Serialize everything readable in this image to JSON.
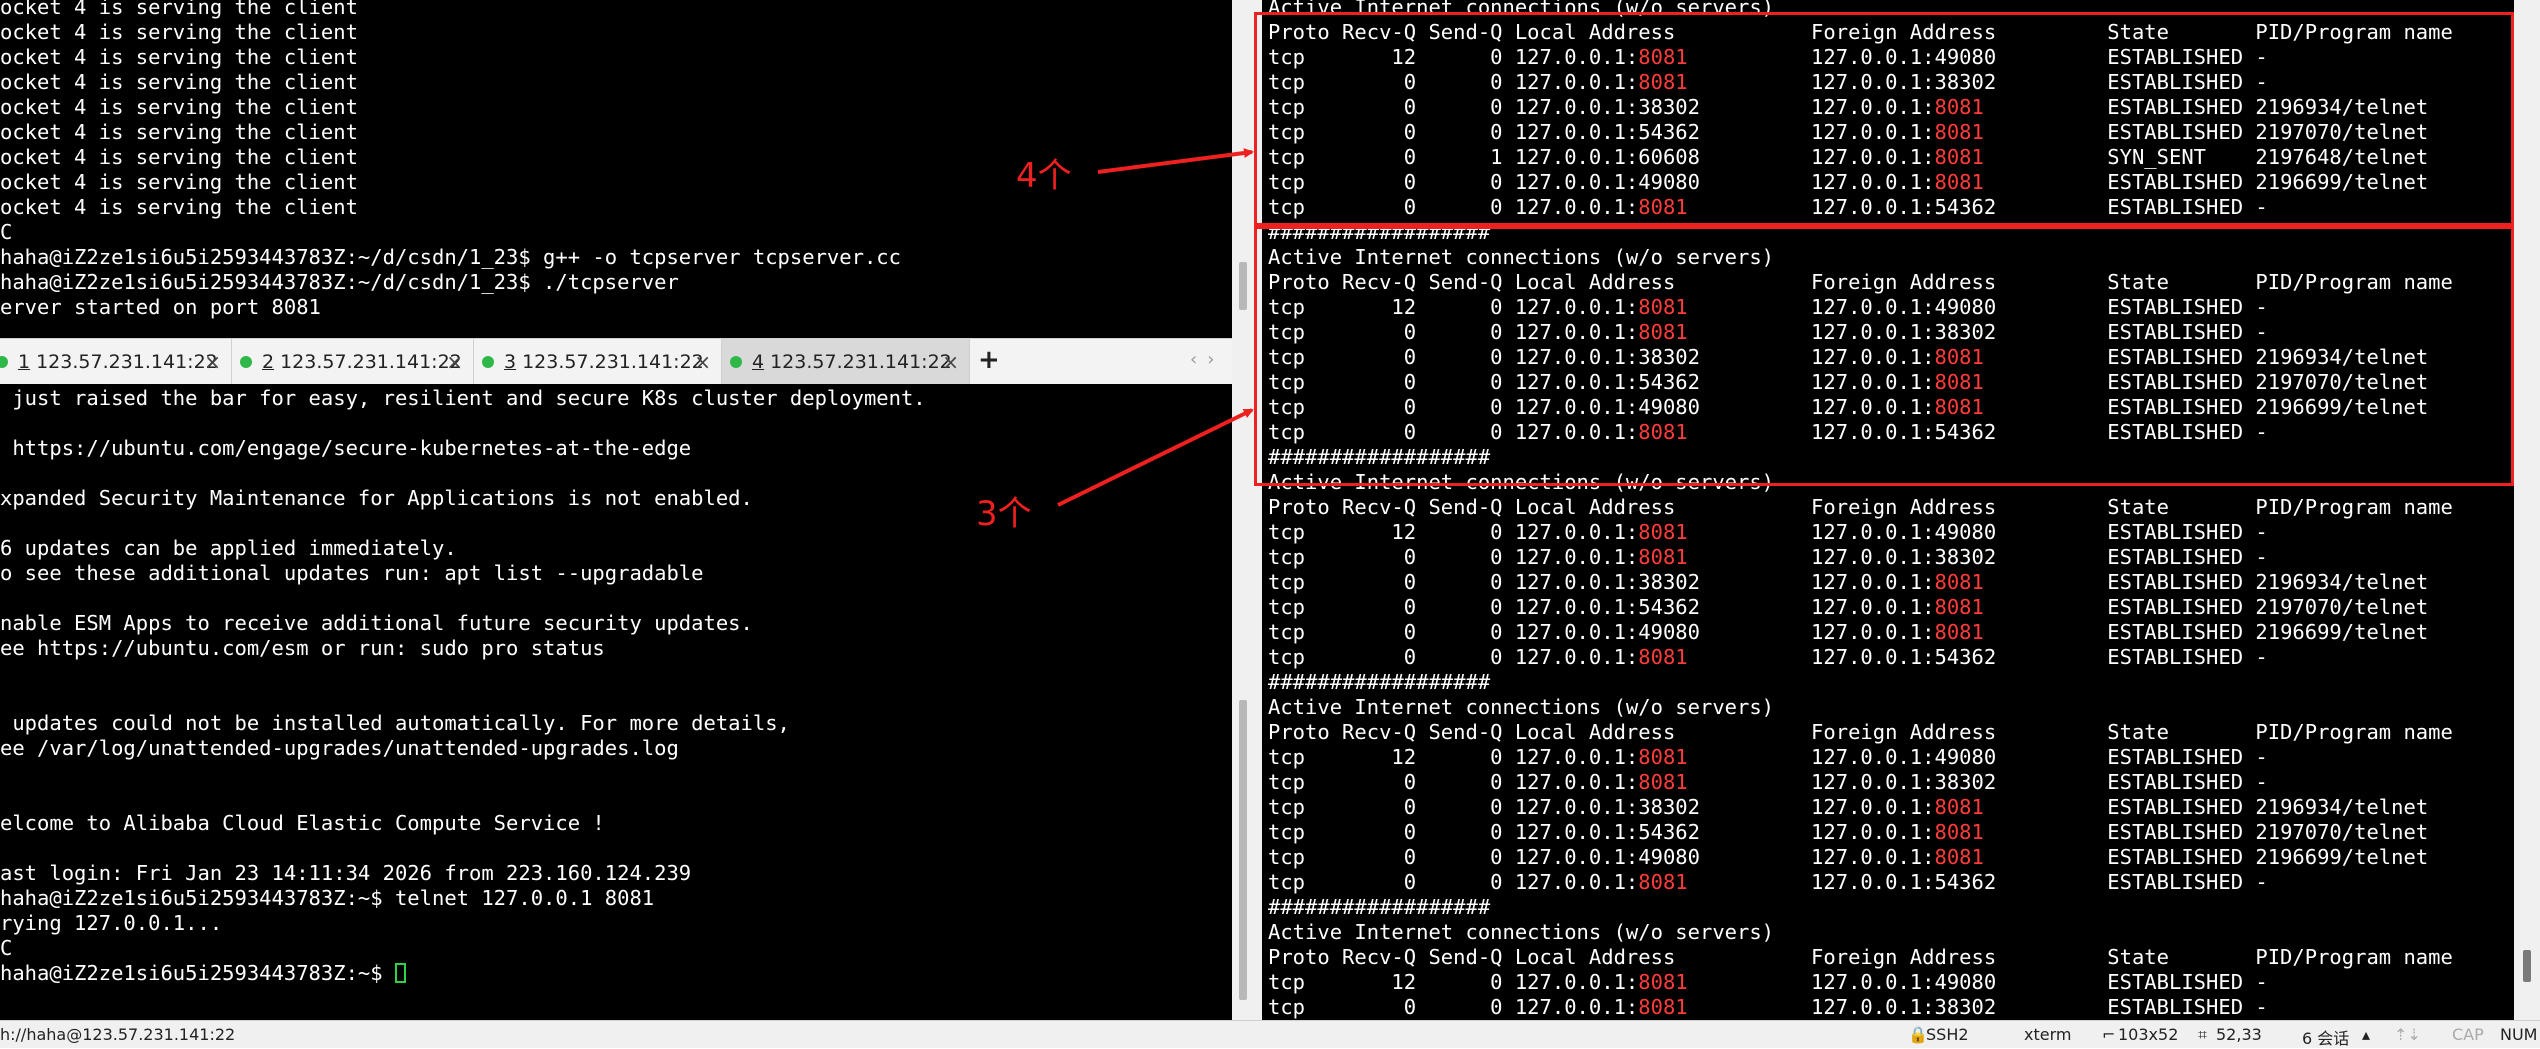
{
  "left_top": {
    "lines": [
      "ocket 4 is serving the client",
      "ocket 4 is serving the client",
      "ocket 4 is serving the client",
      "ocket 4 is serving the client",
      "ocket 4 is serving the client",
      "ocket 4 is serving the client",
      "ocket 4 is serving the client",
      "ocket 4 is serving the client",
      "ocket 4 is serving the client",
      "C",
      "haha@iZ2ze1si6u5i2593443783Z:~/d/csdn/1_23$ g++ -o tcpserver tcpserver.cc",
      "haha@iZ2ze1si6u5i2593443783Z:~/d/csdn/1_23$ ./tcpserver",
      "erver started on port 8081"
    ]
  },
  "tabs": [
    {
      "num": "1",
      "label": "123.57.231.141:22"
    },
    {
      "num": "2",
      "label": "123.57.231.141:22"
    },
    {
      "num": "3",
      "label": "123.57.231.141:22"
    },
    {
      "num": "4",
      "label": "123.57.231.141:22"
    }
  ],
  "tab_add": "+",
  "tab_nav": "‹›",
  "tab_close": "×",
  "left_bottom": {
    "lines": [
      " just raised the bar for easy, resilient and secure K8s cluster deployment.",
      "",
      " https://ubuntu.com/engage/secure-kubernetes-at-the-edge",
      "",
      "xpanded Security Maintenance for Applications is not enabled.",
      "",
      "6 updates can be applied immediately.",
      "o see these additional updates run: apt list --upgradable",
      "",
      "nable ESM Apps to receive additional future security updates.",
      "ee https://ubuntu.com/esm or run: sudo pro status",
      "",
      "",
      " updates could not be installed automatically. For more details,",
      "ee /var/log/unattended-upgrades/unattended-upgrades.log",
      "",
      "",
      "elcome to Alibaba Cloud Elastic Compute Service !",
      "",
      "ast login: Fri Jan 23 14:11:34 2026 from 223.160.124.239",
      "haha@iZ2ze1si6u5i2593443783Z:~$ telnet 127.0.0.1 8081",
      "rying 127.0.0.1...",
      "C"
    ],
    "prompt": "haha@iZ2ze1si6u5i2593443783Z:~$ "
  },
  "netstat": {
    "port": "8081",
    "header": "Proto Recv-Q Send-Q Local Address           Foreign Address         State       PID/Program name",
    "active": "Active Internet connections (w/o servers)",
    "separator": "##################",
    "partial_top": "Active Internet connections (w/o servers)",
    "block_a": [
      [
        "tcp       12      0 127.0.0.1:",
        "8081",
        "          127.0.0.1:49080         ESTABLISHED -"
      ],
      [
        "tcp        0      0 127.0.0.1:",
        "8081",
        "          127.0.0.1:38302         ESTABLISHED -"
      ],
      [
        "tcp        0      0 127.0.0.1:38302         127.0.0.1:",
        "8081",
        "          ESTABLISHED 2196934/telnet"
      ],
      [
        "tcp        0      0 127.0.0.1:54362         127.0.0.1:",
        "8081",
        "          ESTABLISHED 2197070/telnet"
      ],
      [
        "tcp        0      1 127.0.0.1:60608         127.0.0.1:",
        "8081",
        "          SYN_SENT    2197648/telnet"
      ],
      [
        "tcp        0      0 127.0.0.1:49080         127.0.0.1:",
        "8081",
        "          ESTABLISHED 2196699/telnet"
      ],
      [
        "tcp        0      0 127.0.0.1:",
        "8081",
        "          127.0.0.1:54362         ESTABLISHED -"
      ]
    ],
    "block_b": [
      [
        "tcp       12      0 127.0.0.1:",
        "8081",
        "          127.0.0.1:49080         ESTABLISHED -"
      ],
      [
        "tcp        0      0 127.0.0.1:",
        "8081",
        "          127.0.0.1:38302         ESTABLISHED -"
      ],
      [
        "tcp        0      0 127.0.0.1:38302         127.0.0.1:",
        "8081",
        "          ESTABLISHED 2196934/telnet"
      ],
      [
        "tcp        0      0 127.0.0.1:54362         127.0.0.1:",
        "8081",
        "          ESTABLISHED 2197070/telnet"
      ],
      [
        "tcp        0      0 127.0.0.1:49080         127.0.0.1:",
        "8081",
        "          ESTABLISHED 2196699/telnet"
      ],
      [
        "tcp        0      0 127.0.0.1:",
        "8081",
        "          127.0.0.1:54362         ESTABLISHED -"
      ]
    ],
    "block_tail": [
      [
        "tcp       12      0 127.0.0.1:",
        "8081",
        "          127.0.0.1:49080         ESTABLISHED -"
      ],
      [
        "tcp        0      0 127.0.0.1:",
        "8081",
        "          127.0.0.1:38302         ESTABLISHED -"
      ]
    ]
  },
  "annotations": {
    "four": "4个",
    "three": "3个"
  },
  "statusbar": {
    "path": "h://haha@123.57.231.141:22",
    "ssh": "SSH2",
    "term": "xterm",
    "size": "103x52",
    "pos": "52,33",
    "sessions": "6 会话",
    "cap": "CAP",
    "num": "NUM"
  },
  "colors": {
    "accent_red": "#ee2020",
    "port_red": "#ff3b3b",
    "tab_dot_green": "#2fb84a",
    "cursor_green": "#2fd04a"
  }
}
